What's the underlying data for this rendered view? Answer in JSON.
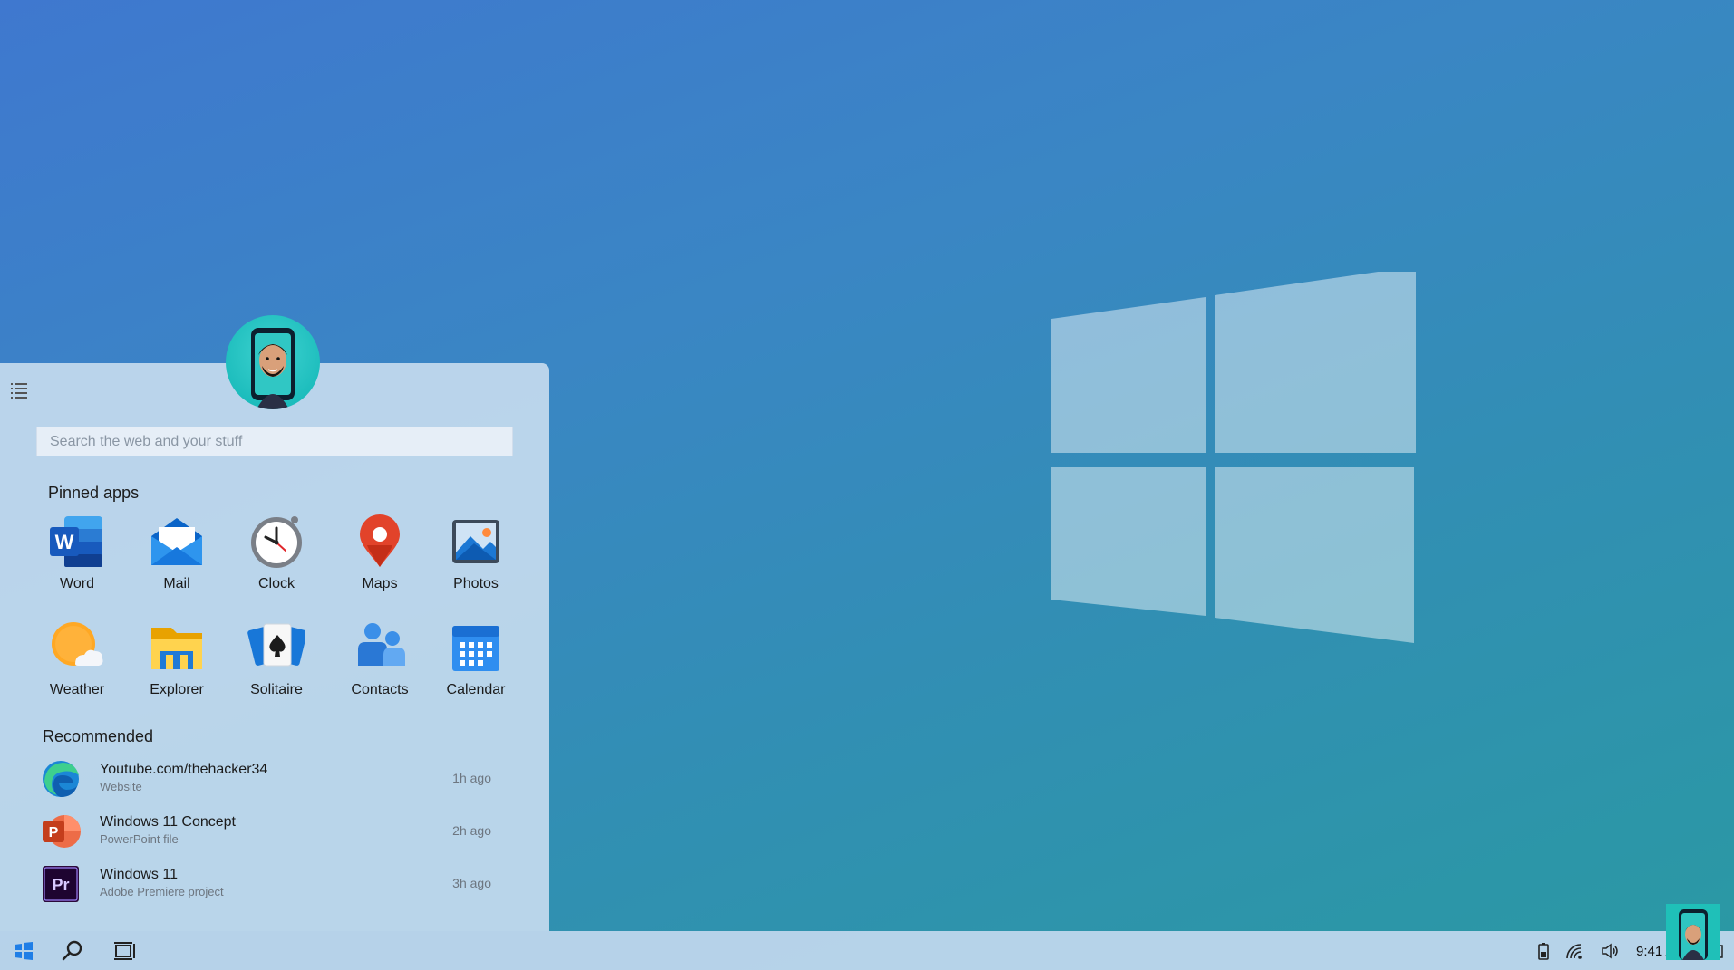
{
  "start_menu": {
    "search": {
      "placeholder": "Search the web and your stuff"
    },
    "pinned_title": "Pinned apps",
    "pinned_apps": [
      {
        "label": "Word",
        "icon": "word-icon"
      },
      {
        "label": "Mail",
        "icon": "mail-icon"
      },
      {
        "label": "Clock",
        "icon": "clock-icon"
      },
      {
        "label": "Maps",
        "icon": "maps-icon"
      },
      {
        "label": "Photos",
        "icon": "photos-icon"
      },
      {
        "label": "Weather",
        "icon": "weather-icon"
      },
      {
        "label": "Explorer",
        "icon": "folder-icon"
      },
      {
        "label": "Solitaire",
        "icon": "cards-icon"
      },
      {
        "label": "Contacts",
        "icon": "people-icon"
      },
      {
        "label": "Calendar",
        "icon": "calendar-icon"
      }
    ],
    "recommended_title": "Recommended",
    "recommended": [
      {
        "name": "Youtube.com/thehacker34",
        "type": "Website",
        "time": "1h ago",
        "icon": "edge-icon"
      },
      {
        "name": "Windows 11 Concept",
        "type": "PowerPoint file",
        "time": "2h ago",
        "icon": "powerpoint-icon"
      },
      {
        "name": "Windows 11",
        "type": "Adobe Premiere project",
        "time": "3h ago",
        "icon": "premiere-icon"
      }
    ]
  },
  "taskbar": {
    "clock": "9:41 AM",
    "tray_icons": [
      "battery-icon",
      "wifi-icon",
      "volume-icon",
      "notification-icon"
    ]
  },
  "colors": {
    "accent": "#0078d7",
    "menu_bg": "#c4daee",
    "avatar_bg": "#17b9b9"
  }
}
